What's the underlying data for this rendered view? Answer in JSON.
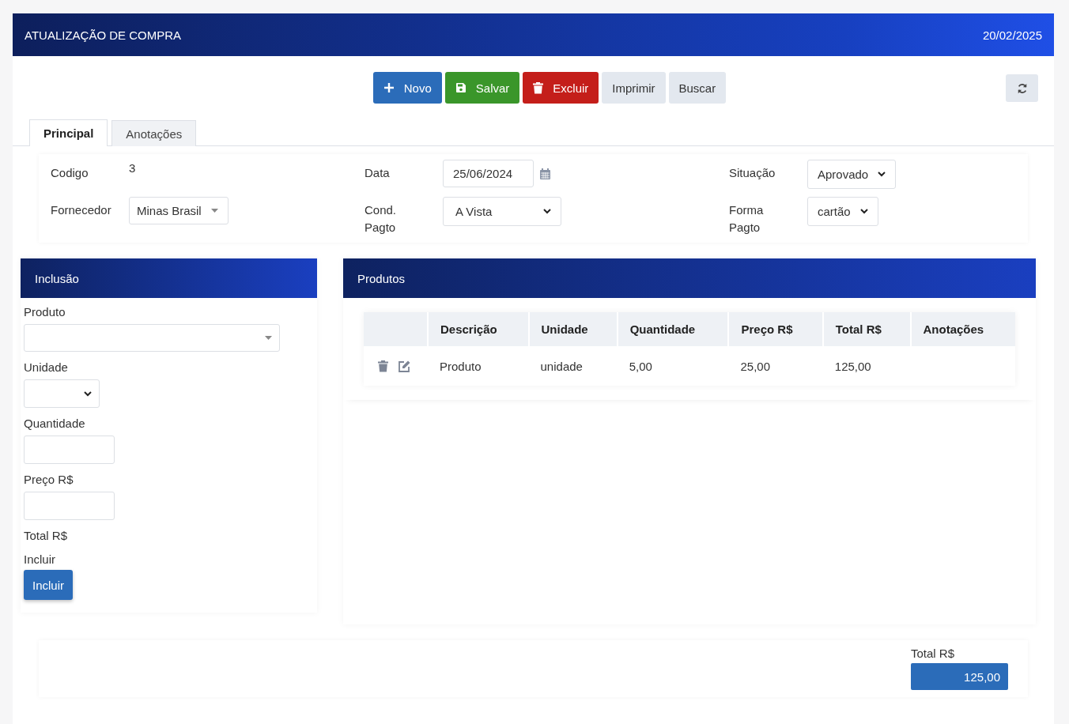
{
  "header": {
    "title": "ATUALIZAÇÃO DE COMPRA",
    "date": "20/02/2025"
  },
  "toolbar": [
    {
      "label": "Novo",
      "kind": "new"
    },
    {
      "label": "Salvar",
      "kind": "save"
    },
    {
      "label": "Excluir",
      "kind": "delete"
    },
    {
      "label": "Imprimir",
      "kind": "plain"
    },
    {
      "label": "Buscar",
      "kind": "plain"
    }
  ],
  "tabs": [
    {
      "label": "Principal",
      "selected": true
    },
    {
      "label": "Anotações",
      "selected": false
    }
  ],
  "form": [
    {
      "label": "Codigo",
      "kind": "text",
      "value": "3"
    },
    {
      "label": "Data",
      "kind": "date",
      "value": "25/06/2024"
    },
    {
      "label": "Situação",
      "kind": "select",
      "value": "Aprovado"
    },
    {
      "label": "Fornecedor",
      "kind": "combo",
      "value": "Minas Brasil"
    },
    {
      "label": "Cond. Pagto",
      "kind": "select",
      "value": "A Vista"
    },
    {
      "label": "Forma Pagto",
      "kind": "select",
      "value": "cartão"
    }
  ],
  "inclusion": {
    "title": "Inclusão",
    "fields": [
      {
        "label": "Produto",
        "kind": "combo"
      },
      {
        "label": "Unidade",
        "kind": "select"
      },
      {
        "label": "Quantidade",
        "kind": "input"
      },
      {
        "label": "Preço R$",
        "kind": "input"
      },
      {
        "label": "Total R$",
        "kind": "none"
      },
      {
        "label": "Incluir",
        "kind": "button",
        "button": "Incluir"
      }
    ]
  },
  "products": {
    "title": "Produtos",
    "columns": [
      "Descrição",
      "Unidade",
      "Quantidade",
      "Preço R$",
      "Total R$",
      "Anotações"
    ],
    "rows": [
      [
        "Produto",
        "unidade",
        "5,00",
        "25,00",
        "125,00",
        ""
      ]
    ]
  },
  "total": {
    "label": "Total R$",
    "value": "125,00"
  }
}
